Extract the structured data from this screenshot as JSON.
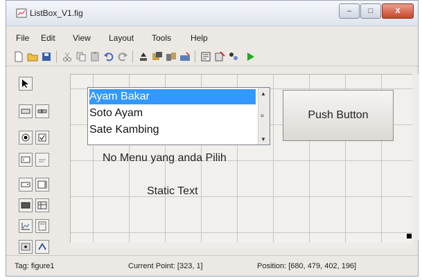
{
  "window": {
    "title": "ListBox_V1.fig",
    "minimize": "–",
    "maximize": "□",
    "close": "X"
  },
  "menu": [
    "File",
    "Edit",
    "View",
    "Layout",
    "Tools",
    "Help"
  ],
  "toolbar_icons": [
    "new-icon",
    "open-icon",
    "save-icon",
    "cut-icon",
    "copy-icon",
    "paste-icon",
    "undo-icon",
    "redo-icon",
    "align-icon",
    "menu-editor-icon",
    "tab-order-icon",
    "toolbar-editor-icon",
    "mfile-editor-icon",
    "property-inspector-icon",
    "object-browser-icon",
    "run-icon"
  ],
  "palette_icons": [
    "select-tool",
    "push-button-tool",
    "slider-tool",
    "radio-button-tool",
    "checkbox-tool",
    "edit-text-tool",
    "static-text-tool",
    "popup-menu-tool",
    "listbox-tool",
    "toggle-button-tool",
    "table-tool",
    "axes-tool",
    "panel-tool",
    "button-group-tool",
    "activex-tool"
  ],
  "listbox": {
    "items": [
      "Ayam Bakar",
      "Soto Ayam",
      "Sate Kambing"
    ],
    "selected_index": 0
  },
  "push_button": {
    "label": "Push Button"
  },
  "static_texts": [
    "No Menu yang anda Pilih",
    "Static Text"
  ],
  "status": {
    "tag": "Tag: figure1",
    "current_point": "Current Point:  [323, 1]",
    "position": "Position: [680, 479, 402, 196]"
  },
  "colors": {
    "selection": "#3399ff",
    "run": "#22aa22"
  }
}
